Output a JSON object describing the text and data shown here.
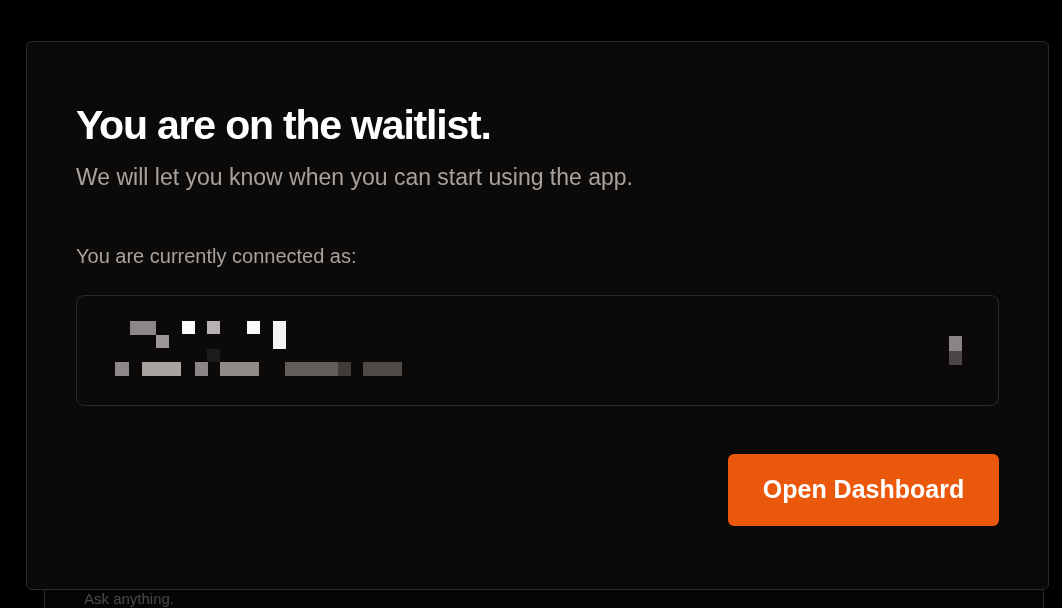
{
  "background": {
    "input_placeholder": "Ask anything."
  },
  "dialog": {
    "title": "You are on the waitlist.",
    "subtitle": "We will let you know when you can start using the app.",
    "account_label": "You are currently connected as:",
    "account": {
      "kind": "redacted"
    },
    "button": "Open Dashboard"
  }
}
